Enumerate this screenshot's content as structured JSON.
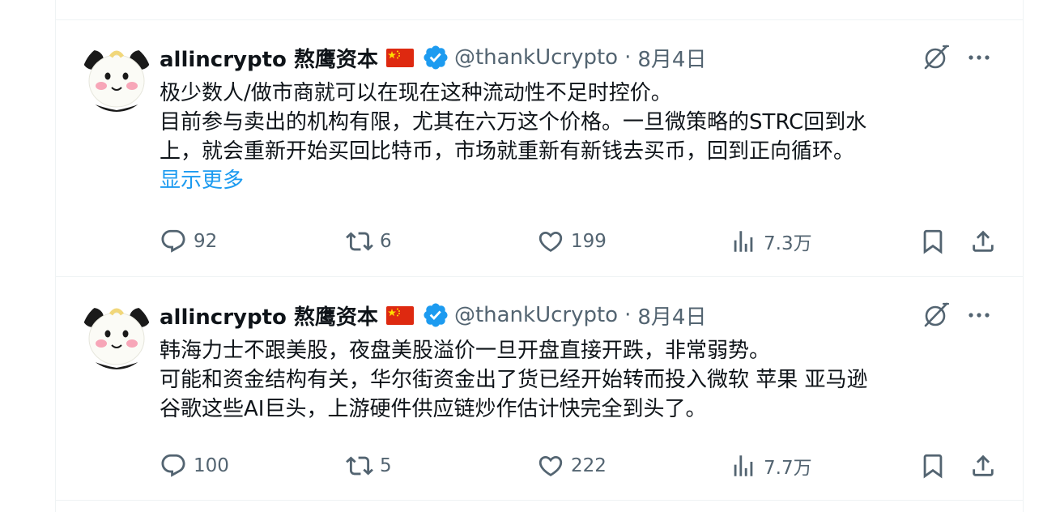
{
  "tweets": [
    {
      "display_name": "allincrypto 熬鹰资本",
      "handle": "@thankUcrypto",
      "separator": "·",
      "date": "8月4日",
      "lines": [
        "极少数人/做市商就可以在现在这种流动性不足时控价。",
        "目前参与卖出的机构有限，尤其在六万这个价格。一旦微策略的STRC回到水",
        "上，就会重新开始买回比特币，市场就重新有新钱去买币，回到正向循环。"
      ],
      "show_more": "显示更多",
      "replies": "92",
      "retweets": "6",
      "likes": "199",
      "views": "7.3万"
    },
    {
      "display_name": "allincrypto 熬鹰资本",
      "handle": "@thankUcrypto",
      "separator": "·",
      "date": "8月4日",
      "lines": [
        "韩海力士不跟美股，夜盘美股溢价一旦开盘直接开跌，非常弱势。",
        "可能和资金结构有关，华尔街资金出了货已经开始转而投入微软 苹果 亚马逊",
        "谷歌这些AI巨头，上游硬件供应链炒作估计快完全到头了。"
      ],
      "replies": "100",
      "retweets": "5",
      "likes": "222",
      "views": "7.7万"
    }
  ],
  "icons": {
    "avatar": "panda-avatar",
    "flag": "china-flag-icon",
    "verified": "verified-badge-icon",
    "grok": "grok-icon",
    "more": "more-icon",
    "reply": "reply-icon",
    "retweet": "retweet-icon",
    "like": "like-icon",
    "views": "views-icon",
    "bookmark": "bookmark-icon",
    "share": "share-icon"
  },
  "colors": {
    "text": "#0f1419",
    "secondary": "#536471",
    "link": "#1d9bf0",
    "verified": "#1d9bf0",
    "divider": "#eff3f4"
  }
}
